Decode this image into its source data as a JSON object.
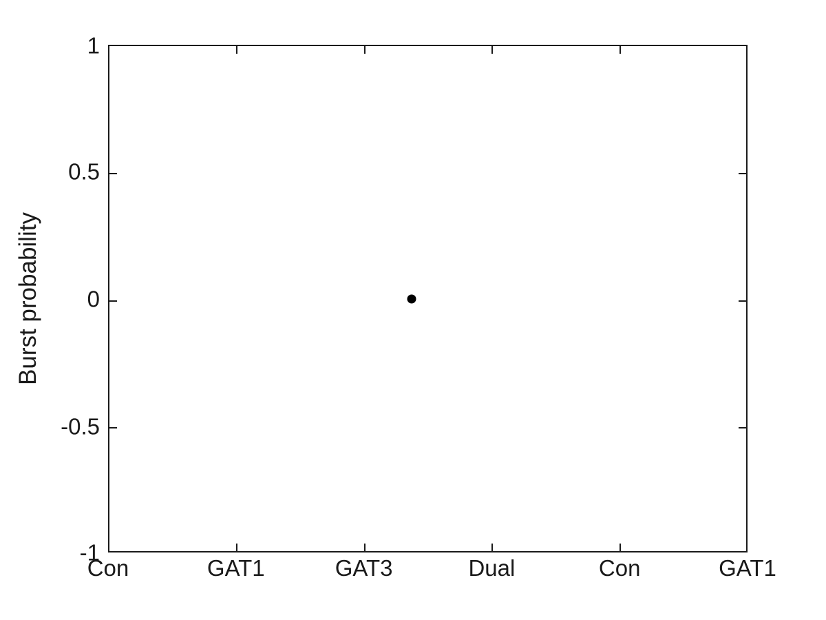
{
  "chart_data": {
    "type": "scatter",
    "title": "",
    "xlabel": "",
    "ylabel": "Burst probability",
    "xlim": [
      0.5,
      6.5
    ],
    "ylim": [
      -1,
      1
    ],
    "grid": false,
    "legend": null,
    "categories": [
      "Con",
      "GAT1",
      "GAT3",
      "Dual",
      "Con",
      "GAT1"
    ],
    "xtick_positions": [
      1,
      2,
      3,
      4,
      5,
      6
    ],
    "xticklabels": [
      "Con",
      "GAT1",
      "GAT3",
      "Dual",
      "Con",
      "GAT1"
    ],
    "yticks": [
      -1,
      -0.5,
      0,
      0.5,
      1
    ],
    "yticklabels": [
      "-1",
      "-0.5",
      "0",
      "0.5",
      "1"
    ],
    "marker_style": "filled-circle",
    "marker_color": "#000000",
    "marker_size": 13,
    "points": [
      {
        "x": 3.35,
        "y": 0
      }
    ],
    "series": [
      {
        "name": "Burst probability",
        "x": [
          3.35
        ],
        "values": [
          0
        ]
      }
    ]
  },
  "axes": {
    "frame_color": "#1a1a1a",
    "background": "#ffffff",
    "tick_direction": "in",
    "box": true
  }
}
